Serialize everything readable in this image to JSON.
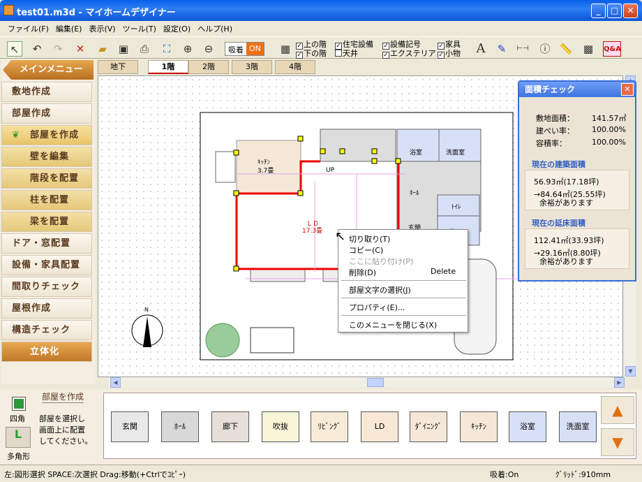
{
  "window": {
    "title": "test01.m3d - マイホームデザイナー",
    "min": "_",
    "max": "□",
    "close": "✕"
  },
  "menu": [
    "ファイル(F)",
    "編集(E)",
    "表示(V)",
    "ツール(T)",
    "設定(O)",
    "ヘルプ(H)"
  ],
  "toolbar": {
    "snap_label": "吸着",
    "snap_state": "ON",
    "checks": [
      {
        "label": "上の階",
        "checked": true
      },
      {
        "label": "下の階",
        "checked": true
      },
      {
        "label": "住宅設備",
        "checked": true
      },
      {
        "label": "天井",
        "checked": false
      },
      {
        "label": "設備記号",
        "checked": true
      },
      {
        "label": "エクステリア",
        "checked": true
      },
      {
        "label": "家具",
        "checked": true
      },
      {
        "label": "小物",
        "checked": true
      }
    ],
    "qa": "Q&A",
    "text_tool": "A"
  },
  "sidebar": {
    "main_menu": "メインメニュー",
    "items": [
      "敷地作成",
      "部屋作成",
      "部屋を作成",
      "壁を編集",
      "階段を配置",
      "柱を配置",
      "梁を配置",
      "ドア・窓配置",
      "設備・家具配置",
      "間取りチェック",
      "屋根作成",
      "構造チェック",
      "立体化"
    ]
  },
  "tabs": [
    "地下",
    "1階",
    "2階",
    "3階",
    "4階"
  ],
  "plan": {
    "kitchen": "ｷｯﾁﾝ",
    "kitchen_size": "3.7畳",
    "ld": "ＬＤ",
    "ld_size": "17.3畳",
    "up": "UP",
    "bath": "浴室",
    "washroom": "洗面室",
    "hall": "ﾎｰﾙ",
    "toilet": "ﾄｲﾚ",
    "entrance": "玄関",
    "storage": "物入",
    "north": "N"
  },
  "context_menu": {
    "cut": "切り取り(T)",
    "copy": "コピー(C)",
    "paste": "ここに貼り付け(P)",
    "delete": "削除(D)",
    "delete_key": "Delete",
    "select_text": "部屋文字の選択(J)",
    "properties": "プロパティ(E)...",
    "close": "このメニューを閉じる(X)"
  },
  "area_check": {
    "title": "面積チェック",
    "site_label": "敷地面積：",
    "site_value": "141.57㎡",
    "coverage_label": "建ぺい率：",
    "coverage_value": "100.00%",
    "far_label": "容積率：",
    "far_value": "100.00%",
    "building_area_title": "現在の建築面積",
    "building_area_value": "56.93㎡(17.18坪)",
    "building_area_limit": "→84.64㎡(25.55坪)",
    "building_area_note": "余裕があります",
    "floor_area_title": "現在の延床面積",
    "floor_area_value": "112.41㎡(33.93坪)",
    "floor_area_limit": "→29.16㎡(8.80坪)",
    "floor_area_note": "余裕があります"
  },
  "bottom": {
    "mode_title": "部屋を作成",
    "mode_desc": [
      "部屋を選択し",
      "画面上に配置",
      "してください。"
    ],
    "square": "四角",
    "polygon": "多角形",
    "rooms": [
      {
        "label": "玄関",
        "color": "#e8e8e8"
      },
      {
        "label": "ﾎｰﾙ",
        "color": "#d8d8d8"
      },
      {
        "label": "廊下",
        "color": "#e8e0d8"
      },
      {
        "label": "吹抜",
        "color": "#f8f5d8"
      },
      {
        "label": "ﾘﾋﾞﾝｸﾞ",
        "color": "#f8ecd8"
      },
      {
        "label": "LD",
        "color": "#f8e8d5"
      },
      {
        "label": "ﾀﾞｲﾆﾝｸﾞ",
        "color": "#f5e8d8"
      },
      {
        "label": "ｷｯﾁﾝ",
        "color": "#f5e8d8"
      },
      {
        "label": "浴室",
        "color": "#d8e0f8"
      },
      {
        "label": "洗面室",
        "color": "#d8e0f5"
      }
    ]
  },
  "status": {
    "help": "左:図形選択 SPACE:次選択 Drag:移動(+Ctrlでｺﾋﾟｰ)",
    "snap": "吸着:On",
    "grid": "ｸﾞﾘｯﾄﾞ:910mm"
  }
}
